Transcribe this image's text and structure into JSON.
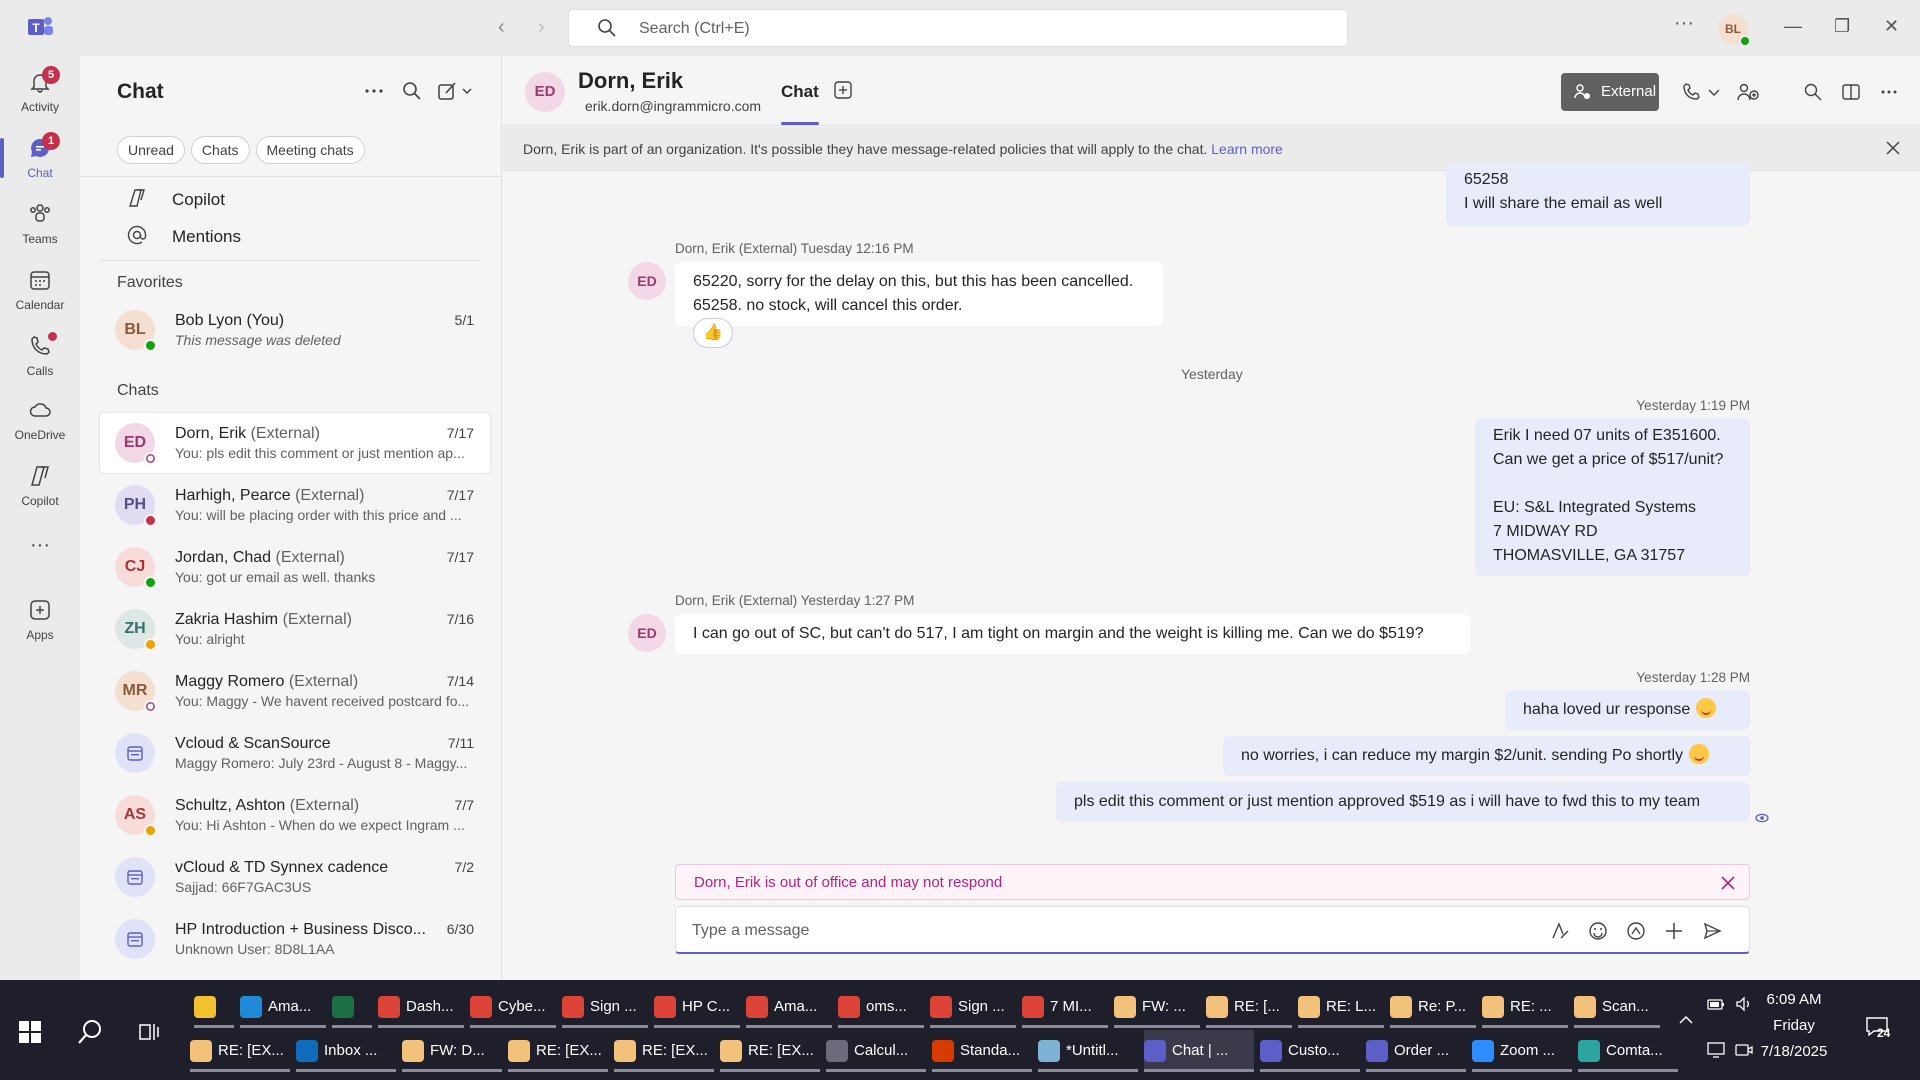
{
  "titlebar": {
    "search_placeholder": "Search (Ctrl+E)",
    "avatar_initials": "BL",
    "more_label": "···"
  },
  "rail": {
    "items": [
      {
        "label": "Activity",
        "badge": "5"
      },
      {
        "label": "Chat",
        "badge": "1"
      },
      {
        "label": "Teams"
      },
      {
        "label": "Calendar"
      },
      {
        "label": "Calls"
      },
      {
        "label": "OneDrive"
      },
      {
        "label": "Copilot"
      },
      {
        "label": "···"
      },
      {
        "label": "Apps"
      }
    ]
  },
  "list": {
    "title": "Chat",
    "filters": [
      "Unread",
      "Chats",
      "Meeting chats"
    ],
    "pinned": [
      {
        "label": "Copilot"
      },
      {
        "label": "Mentions"
      }
    ],
    "favorites_heading": "Favorites",
    "favorites": [
      {
        "initials": "BL",
        "name": "Bob Lyon (You)",
        "ext": "",
        "date": "5/1",
        "preview": "This message was deleted",
        "avatar_bg": "#f4dfd0",
        "avatar_fg": "#8a5a3b",
        "status": "#13a10e"
      }
    ],
    "chats_heading": "Chats",
    "chats": [
      {
        "initials": "ED",
        "name": "Dorn, Erik",
        "ext": "(External)",
        "date": "7/17",
        "preview": "You: pls edit this comment or just mention ap...",
        "avatar_bg": "#f2d7e6",
        "avatar_fg": "#9b3a6e",
        "status": "#ffffff",
        "selected": true
      },
      {
        "initials": "PH",
        "name": "Harhigh, Pearce",
        "ext": "(External)",
        "date": "7/17",
        "preview": "You: will be placing order with this price and ...",
        "avatar_bg": "#e2dcf3",
        "avatar_fg": "#5b4b8a",
        "status": "#c4314b"
      },
      {
        "initials": "CJ",
        "name": "Jordan, Chad",
        "ext": "(External)",
        "date": "7/17",
        "preview": "You: got ur email as well. thanks",
        "avatar_bg": "#f8dcd9",
        "avatar_fg": "#a4373a",
        "status": "#13a10e"
      },
      {
        "initials": "ZH",
        "name": "Zakria Hashim",
        "ext": "(External)",
        "date": "7/16",
        "preview": "You: alright",
        "avatar_bg": "#dde8e6",
        "avatar_fg": "#37706a",
        "status": "#eaa300"
      },
      {
        "initials": "MR",
        "name": "Maggy Romero",
        "ext": "(External)",
        "date": "7/14",
        "preview": "You: Maggy - We havent received postcard fo...",
        "avatar_bg": "#f4dfd0",
        "avatar_fg": "#8a5a3b",
        "status": "#ffffff"
      },
      {
        "initials": "",
        "name": "Vcloud & ScanSource",
        "ext": "",
        "date": "7/11",
        "preview": "Maggy Romero: July 23rd - August 8 - Maggy...",
        "avatar_bg": "#e0e3f7",
        "avatar_fg": "#5b5fc7",
        "status": ""
      },
      {
        "initials": "AS",
        "name": "Schultz, Ashton",
        "ext": "(External)",
        "date": "7/7",
        "preview": "You: Hi Ashton -  When do we expect Ingram ...",
        "avatar_bg": "#f8dcd9",
        "avatar_fg": "#a4373a",
        "status": "#eaa300"
      },
      {
        "initials": "",
        "name": "vCloud & TD Synnex cadence",
        "ext": "",
        "date": "7/2",
        "preview": "Sajjad: 66F7GAC3US",
        "avatar_bg": "#e0e3f7",
        "avatar_fg": "#5b5fc7",
        "status": ""
      },
      {
        "initials": "",
        "name": "HP Introduction + Business Disco...",
        "ext": "",
        "date": "6/30",
        "preview": "Unknown User: 8D8L1AA",
        "avatar_bg": "#e0e3f7",
        "avatar_fg": "#5b5fc7",
        "status": ""
      }
    ]
  },
  "header": {
    "initials": "ED",
    "name": "Dorn, Erik",
    "email": "erik.dorn@ingrammicro.com",
    "tab": "Chat",
    "external_label": "External"
  },
  "banner": {
    "text": "Dorn, Erik is part of an organization. It's possible they have message-related policies that will apply to the chat.",
    "link": "Learn more"
  },
  "messages": {
    "top_out": {
      "line1": "65258",
      "line2": "I will share the email as well"
    },
    "m1": {
      "meta": "Dorn, Erik (External)   Tuesday 12:16 PM",
      "line1": "65220, sorry for the delay on this, but this has been cancelled.",
      "line2": "65258. no stock, will cancel this order.",
      "initials": "ED",
      "reaction": "👍"
    },
    "day": "Yesterday",
    "m2": {
      "meta": "Yesterday 1:19 PM",
      "lines": [
        "Erik I need 07 units of E351600.",
        "Can we get a price of $517/unit?",
        "",
        "EU: S&L Integrated Systems",
        "7 MIDWAY RD",
        "THOMASVILLE, GA 31757"
      ]
    },
    "m3": {
      "meta": "Dorn, Erik (External)   Yesterday 1:27 PM",
      "text": "I can go out of SC, but can't do 517, I am tight on margin and the weight is killing me.  Can we do $519?",
      "initials": "ED"
    },
    "m4": {
      "meta": "Yesterday 1:28 PM",
      "a": "haha loved ur response",
      "b": "no worries, i can reduce my margin $2/unit. sending Po shortly",
      "c": "pls edit this comment or just mention approved $519 as i will have to fwd this to my team"
    }
  },
  "ooo": {
    "text": "Dorn, Erik is out of office and may not respond"
  },
  "composer": {
    "placeholder": "Type a message"
  },
  "taskbar": {
    "row1": [
      {
        "label": "",
        "color": "#f2c12e"
      },
      {
        "label": "Ama...",
        "color": "#1f8ad8"
      },
      {
        "label": "",
        "color": "#1d7044"
      },
      {
        "label": "Dash...",
        "color": "#db4437"
      },
      {
        "label": "Cybe...",
        "color": "#db4437"
      },
      {
        "label": "Sign ...",
        "color": "#db4437"
      },
      {
        "label": "HP C...",
        "color": "#db4437"
      },
      {
        "label": "Ama...",
        "color": "#db4437"
      },
      {
        "label": "oms...",
        "color": "#db4437"
      },
      {
        "label": "Sign ...",
        "color": "#db4437"
      },
      {
        "label": "7 MI...",
        "color": "#db4437"
      },
      {
        "label": "FW: ...",
        "color": "#f3c27a"
      },
      {
        "label": "RE: [...",
        "color": "#f3c27a"
      },
      {
        "label": "RE: L...",
        "color": "#f3c27a"
      },
      {
        "label": "Re: P...",
        "color": "#f3c27a"
      },
      {
        "label": "RE: ...",
        "color": "#f3c27a"
      },
      {
        "label": "Scan...",
        "color": "#f3c27a"
      }
    ],
    "row2": [
      {
        "label": "RE: [EX...",
        "color": "#f3c27a"
      },
      {
        "label": "Inbox ...",
        "color": "#0f6cbd"
      },
      {
        "label": "FW: D...",
        "color": "#f3c27a"
      },
      {
        "label": "RE: [EX...",
        "color": "#f3c27a"
      },
      {
        "label": "RE: [EX...",
        "color": "#f3c27a"
      },
      {
        "label": "RE: [EX...",
        "color": "#f3c27a"
      },
      {
        "label": "Calcul...",
        "color": "#6b6b7b"
      },
      {
        "label": "Standa...",
        "color": "#d83b01"
      },
      {
        "label": "*Untitl...",
        "color": "#7fb3d5"
      },
      {
        "label": "Chat | ...",
        "color": "#5b5fc7"
      },
      {
        "label": "Custo...",
        "color": "#5b5fc7"
      },
      {
        "label": "Order ...",
        "color": "#5b5fc7"
      },
      {
        "label": "Zoom ...",
        "color": "#2d8cff"
      },
      {
        "label": "Comta...",
        "color": "#2aa5a0"
      }
    ],
    "time": "6:09 AM",
    "day": "Friday",
    "date": "7/18/2025",
    "notif": "24"
  }
}
